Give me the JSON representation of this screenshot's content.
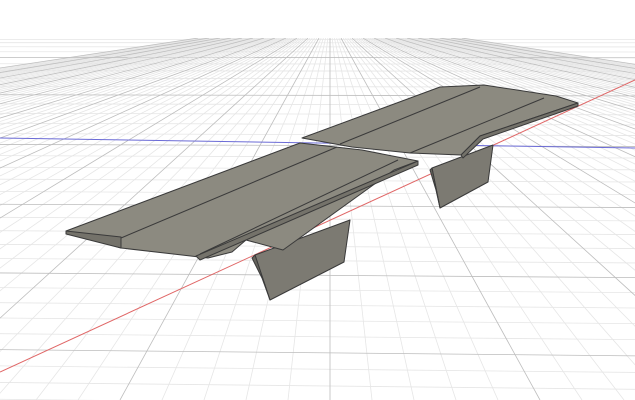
{
  "viewport": {
    "view": "perspective",
    "background_color": "#ffffff",
    "grid": {
      "visible": true,
      "minor_color": "#e6e6e6",
      "major_color": "#bdbdbd"
    },
    "axes": {
      "x_axis_color": "#e06666",
      "y_axis_color": "#6b6bd6"
    },
    "model": {
      "name": "bridge-deck-model",
      "segments": 2,
      "piers": 2,
      "deck_top_color": "#8c8a80",
      "deck_shade_color": "#74726a",
      "edge_color": "#3a3a3a",
      "pier_color": "#7c7a72",
      "pier_shadow_color": "#65635c"
    }
  }
}
